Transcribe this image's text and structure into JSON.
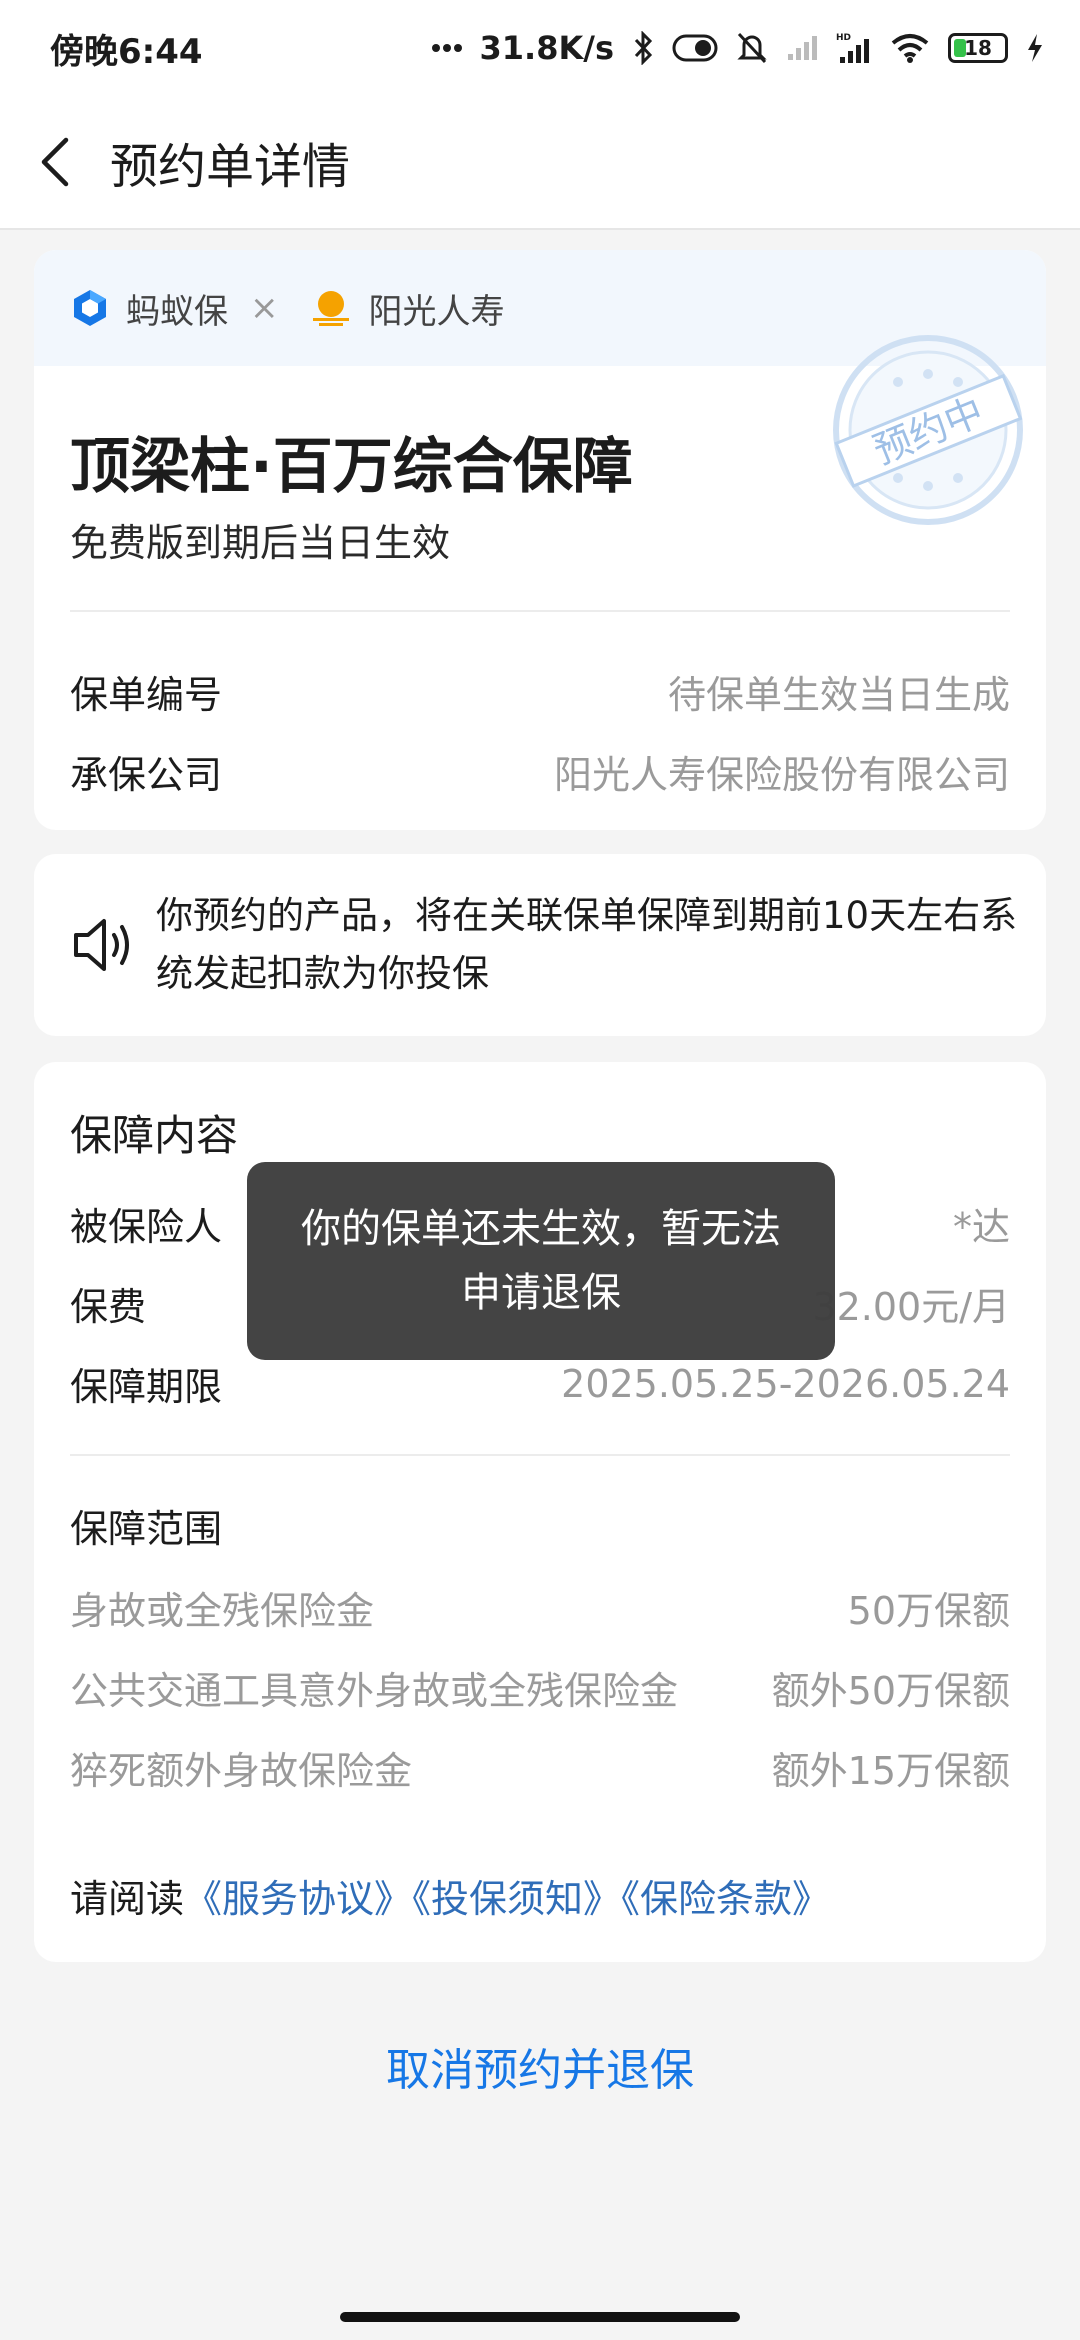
{
  "status_bar": {
    "time": "傍晚6:44",
    "network_speed": "31.8K/s",
    "battery": "18",
    "icons": [
      "dots-icon",
      "bluetooth-icon",
      "toggle-icon",
      "mute-icon",
      "signal-icon",
      "hd-signal-icon",
      "wifi-icon",
      "battery-icon",
      "charging-icon"
    ]
  },
  "header": {
    "title": "预约单详情",
    "back_icon": "chevron-left-icon"
  },
  "brands": {
    "platform": "蚂蚁保",
    "insurer": "阳光人寿",
    "colors": {
      "platform_blue": "#1677e6",
      "insurer_orange": "#f5a200"
    }
  },
  "product": {
    "title": "顶梁柱·百万综合保障",
    "subtitle": "免费版到期后当日生效",
    "stamp": "预约中"
  },
  "policy_info": [
    {
      "label": "保单编号",
      "value": "待保单生效当日生成"
    },
    {
      "label": "承保公司",
      "value": "阳光人寿保险股份有限公司"
    }
  ],
  "notice": {
    "icon": "speaker-icon",
    "text": "你预约的产品，将在关联保单保障到期前10天左右系统发起扣款为你投保"
  },
  "coverage": {
    "title": "保障内容",
    "details": [
      {
        "label": "被保险人",
        "value": "*达"
      },
      {
        "label": "保费",
        "value": "32.00元/月"
      },
      {
        "label": "保障期限",
        "value": "2025.05.25-2026.05.24"
      }
    ],
    "scope_title": "保障范围",
    "scope": [
      {
        "label": "身故或全残保险金",
        "value": "50万保额"
      },
      {
        "label": "公共交通工具意外身故或全残保险金",
        "value": "额外50万保额"
      },
      {
        "label": "猝死额外身故保险金",
        "value": "额外15万保额"
      }
    ],
    "read_prefix": "请阅读",
    "links": [
      "《服务协议》",
      "《投保须知》",
      "《保险条款》"
    ]
  },
  "cancel_button": "取消预约并退保",
  "toast": {
    "line1": "你的保单还未生效，暂无法",
    "line2": "申请退保"
  }
}
